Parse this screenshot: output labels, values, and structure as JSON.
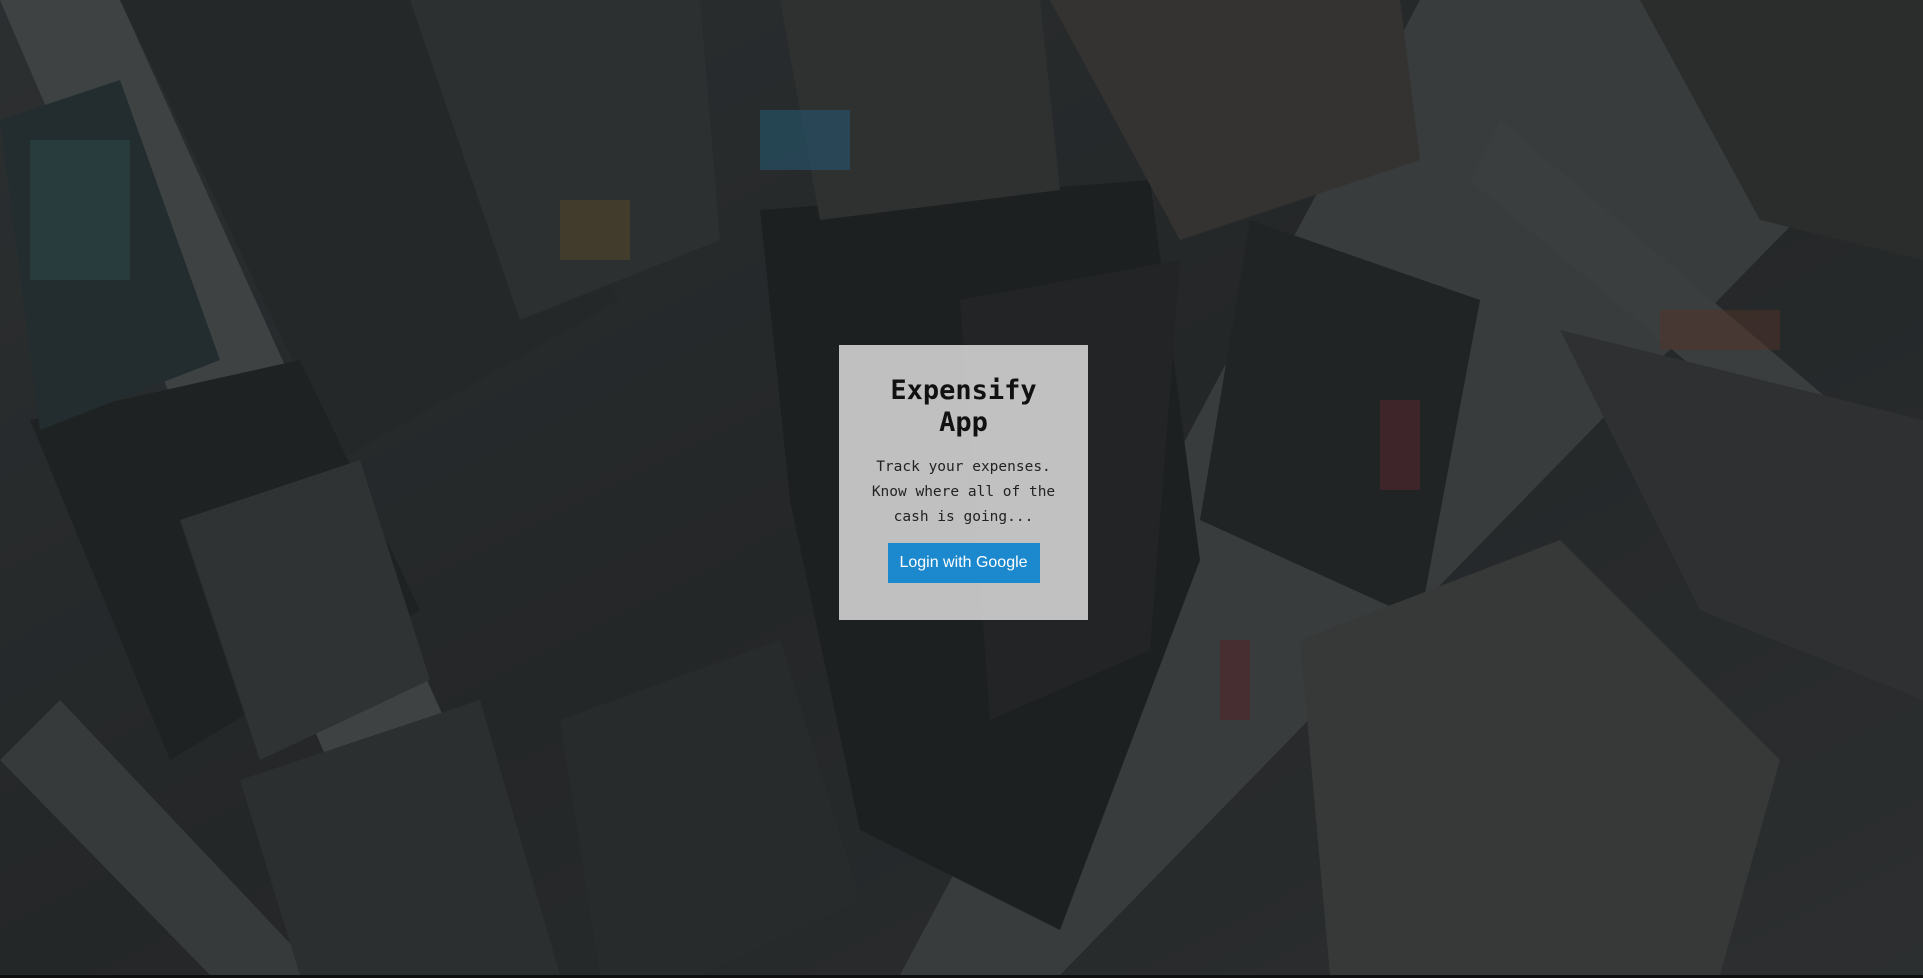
{
  "login": {
    "title": "Expensify App",
    "subtitle": "Track your expenses. Know where all of the cash is going...",
    "button_label": "Login with Google"
  },
  "background": {
    "description_icon": "city-aerial-photo"
  },
  "colors": {
    "button": "#1c88cd",
    "box": "#e4e4e4"
  }
}
